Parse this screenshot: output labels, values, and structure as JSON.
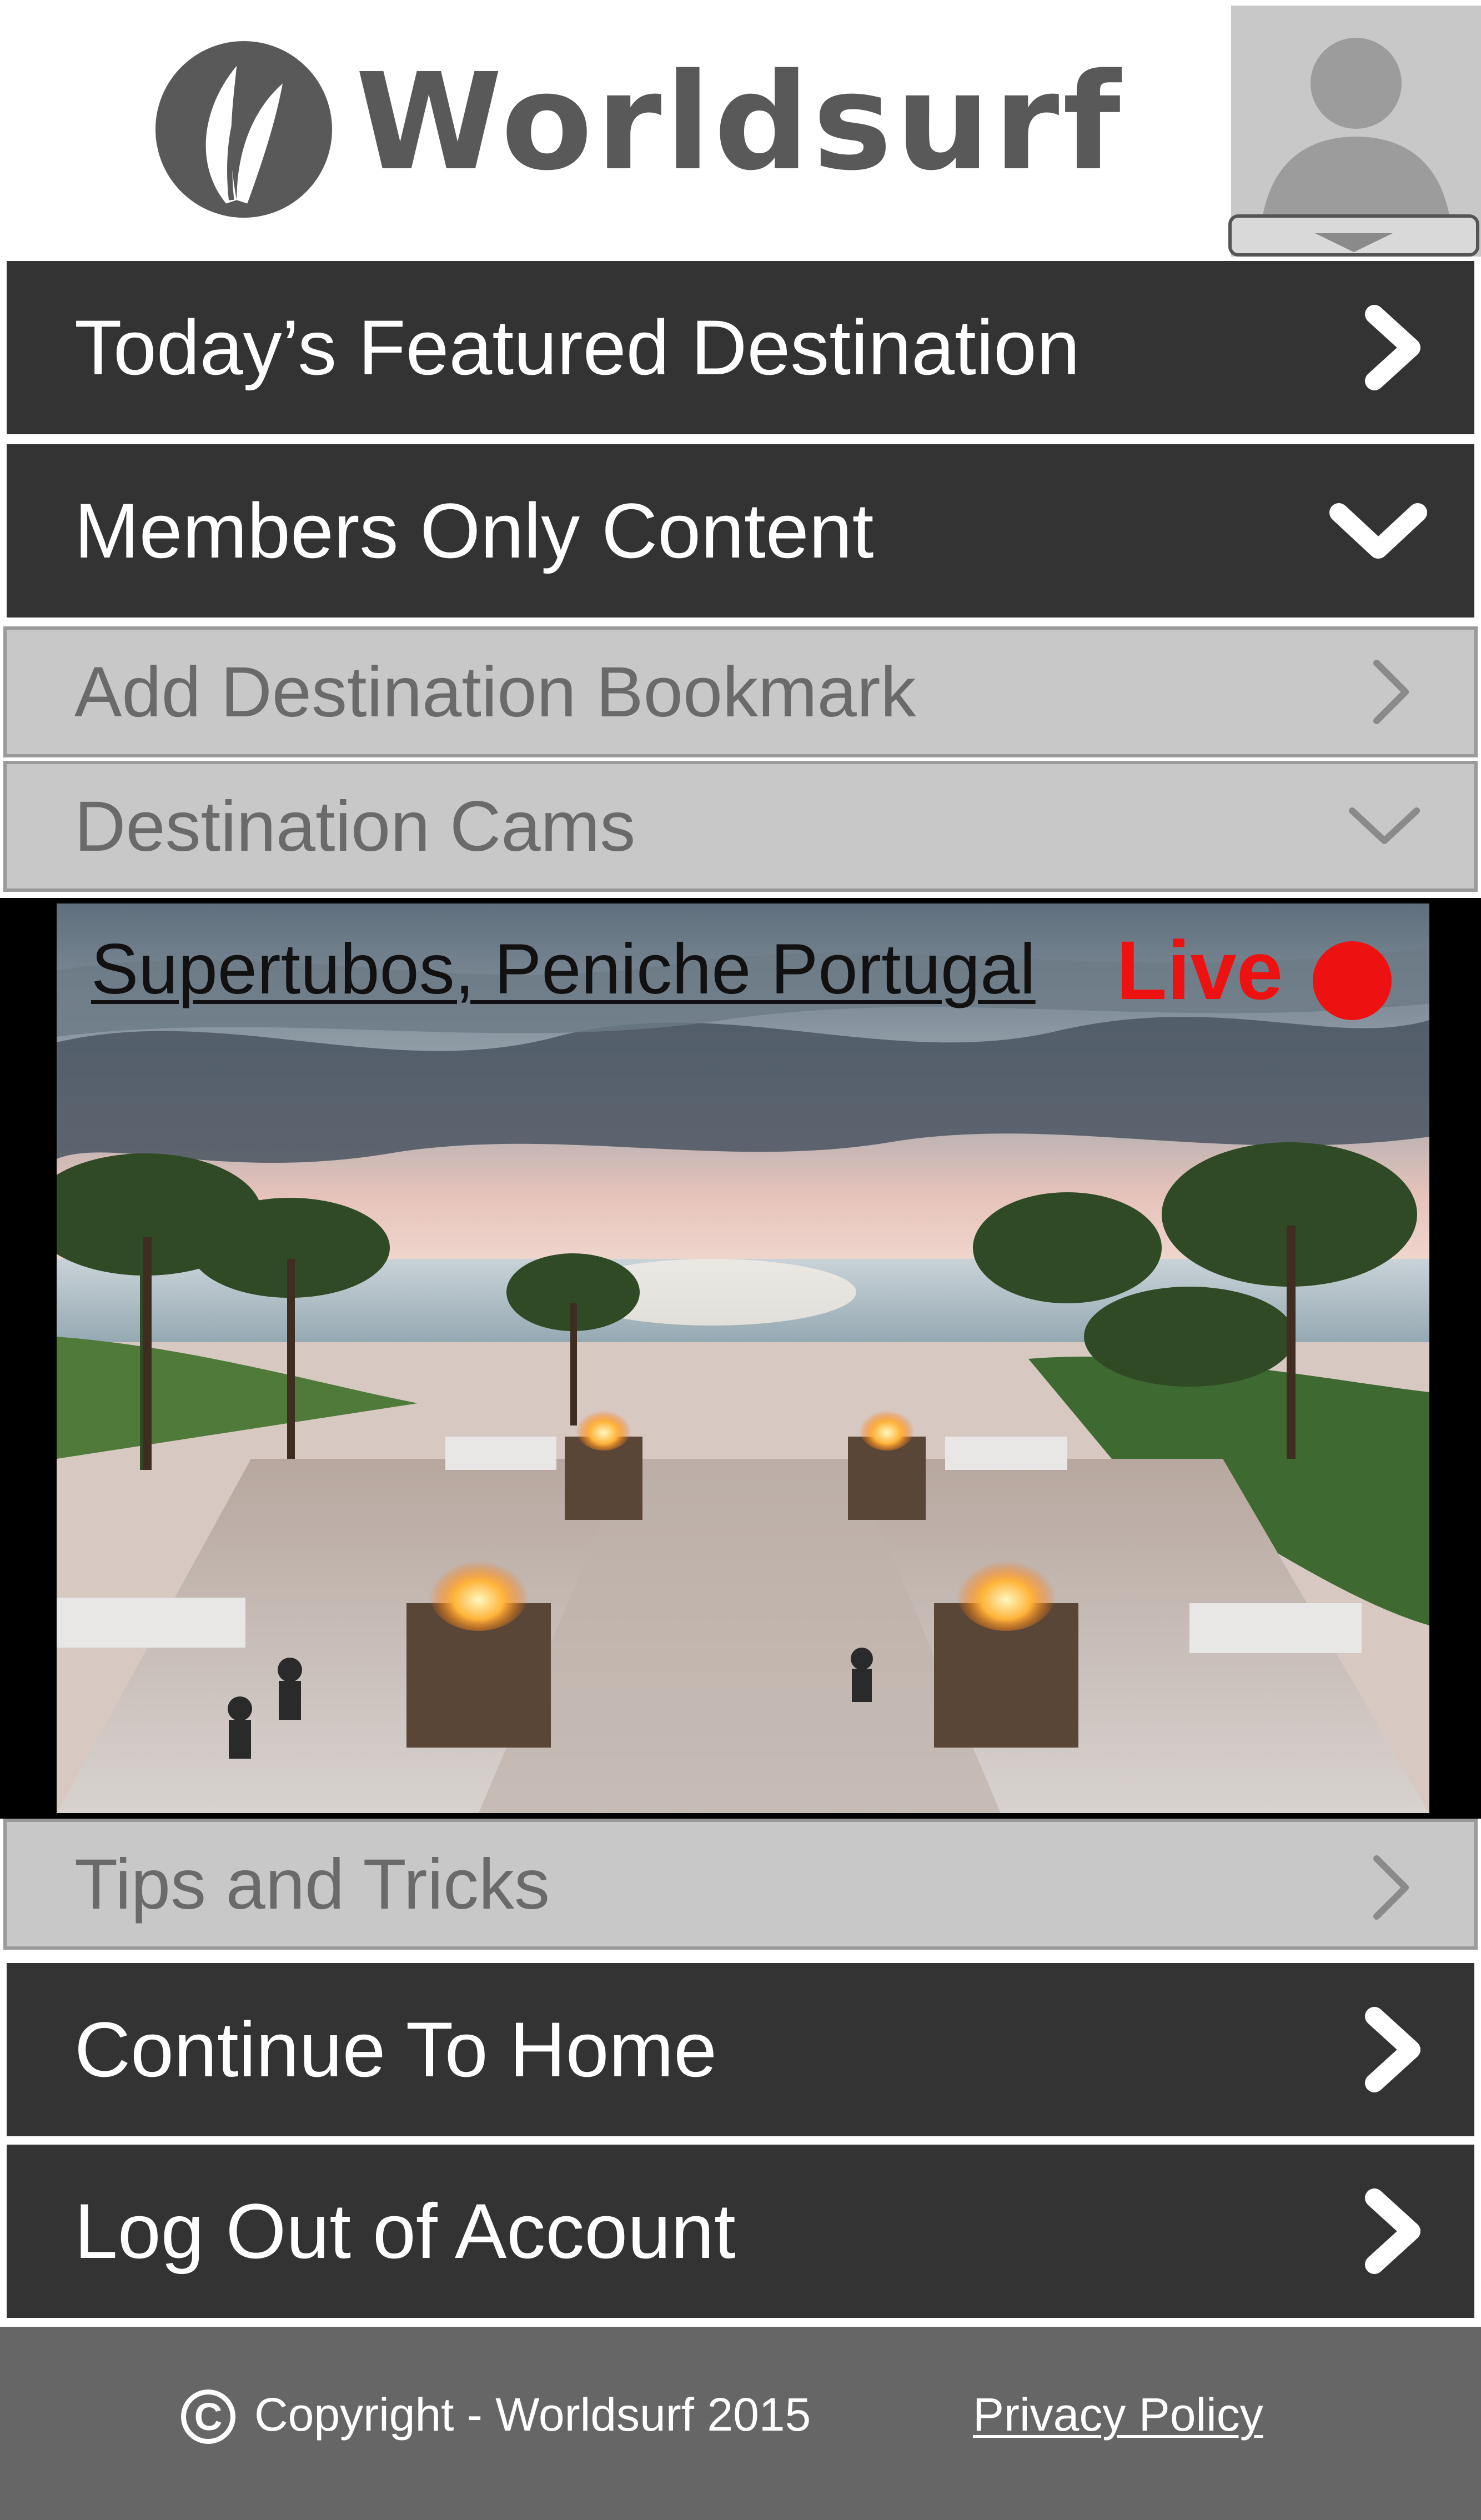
{
  "app": {
    "name": "Worldsurf"
  },
  "header": {
    "logo_text": "Worldsurf",
    "logo_icon": "feather-logo-icon",
    "avatar_icon": "user-avatar-icon",
    "avatar_menu_icon": "triangle-down-icon"
  },
  "menu": {
    "featured": {
      "label": "Today’s Featured Destination",
      "icon": "chevron-right-icon"
    },
    "members": {
      "label": "Members Only Content",
      "icon": "chevron-down-icon"
    },
    "bookmark": {
      "label": "Add Destination Bookmark",
      "icon": "chevron-right-icon"
    },
    "cams": {
      "label": "Destination Cams",
      "icon": "chevron-down-icon"
    },
    "tips": {
      "label": "Tips and Tricks",
      "icon": "chevron-right-icon"
    },
    "home": {
      "label": "Continue To Home",
      "icon": "chevron-right-icon"
    },
    "logout": {
      "label": "Log Out of Account",
      "icon": "chevron-right-icon"
    }
  },
  "cam": {
    "location": "Supertubos, Peniche Portugal",
    "status": "Live",
    "status_icon": "live-dot-icon"
  },
  "footer": {
    "copyright_symbol": "C",
    "copyright": "Copyright - Worldsurf 2015",
    "privacy": "Privacy Policy"
  },
  "colors": {
    "dark_bar": "#333333",
    "light_bar": "#c8c8c8",
    "footer": "#666666",
    "live": "#ee1111",
    "logo": "#595959"
  }
}
